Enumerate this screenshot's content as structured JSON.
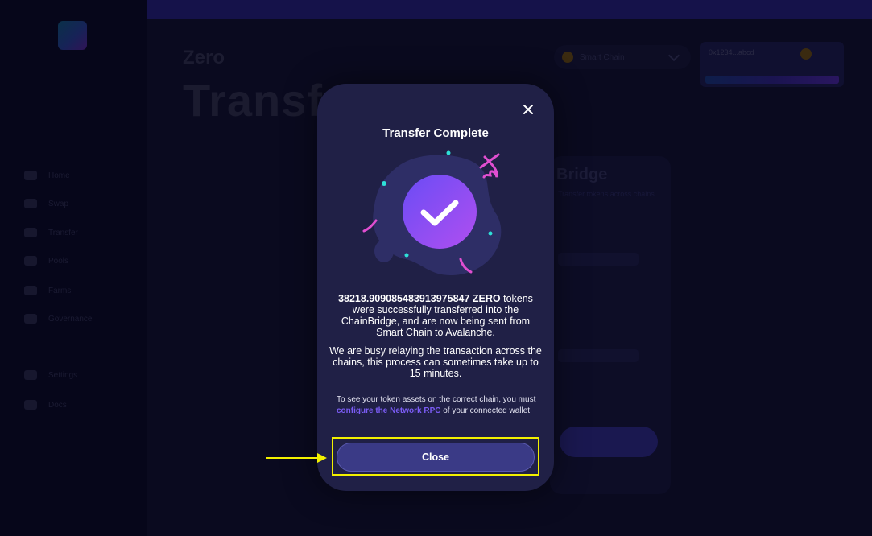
{
  "background": {
    "page_subtitle": "Zero",
    "page_title": "Transfer",
    "sidebar_items": [
      "Home",
      "Swap",
      "Transfer",
      "Pools",
      "Farms",
      "Governance",
      "Settings",
      "Docs"
    ],
    "network_label": "Smart Chain",
    "wallet_label": "0x1234...abcd",
    "card_title": "Bridge",
    "card_subtitle": "Transfer tokens across chains"
  },
  "modal": {
    "title": "Transfer Complete",
    "message_amount": "38218.909085483913975847 ZERO",
    "message_rest": " tokens were successfully transferred into the ChainBridge, and are now being sent from Smart Chain to Avalanche.",
    "message_relay": "We are busy relaying the transaction across the chains, this process can sometimes take up to 15 minutes.",
    "note_before": "To see your token assets on the correct chain, you must ",
    "note_link": "configure the Network RPC",
    "note_after": " of your connected wallet.",
    "close_button": "Close",
    "close_icon": "close-icon",
    "success_icon": "check-icon"
  },
  "colors": {
    "modal_bg": "#202046",
    "accent": "#7b5cf5",
    "check_gradient_start": "#6a4cf5",
    "check_gradient_end": "#b04ff0",
    "confetti_pink": "#e04ed0",
    "confetti_teal": "#2ee0d8",
    "annotation_yellow": "#f2f000"
  }
}
